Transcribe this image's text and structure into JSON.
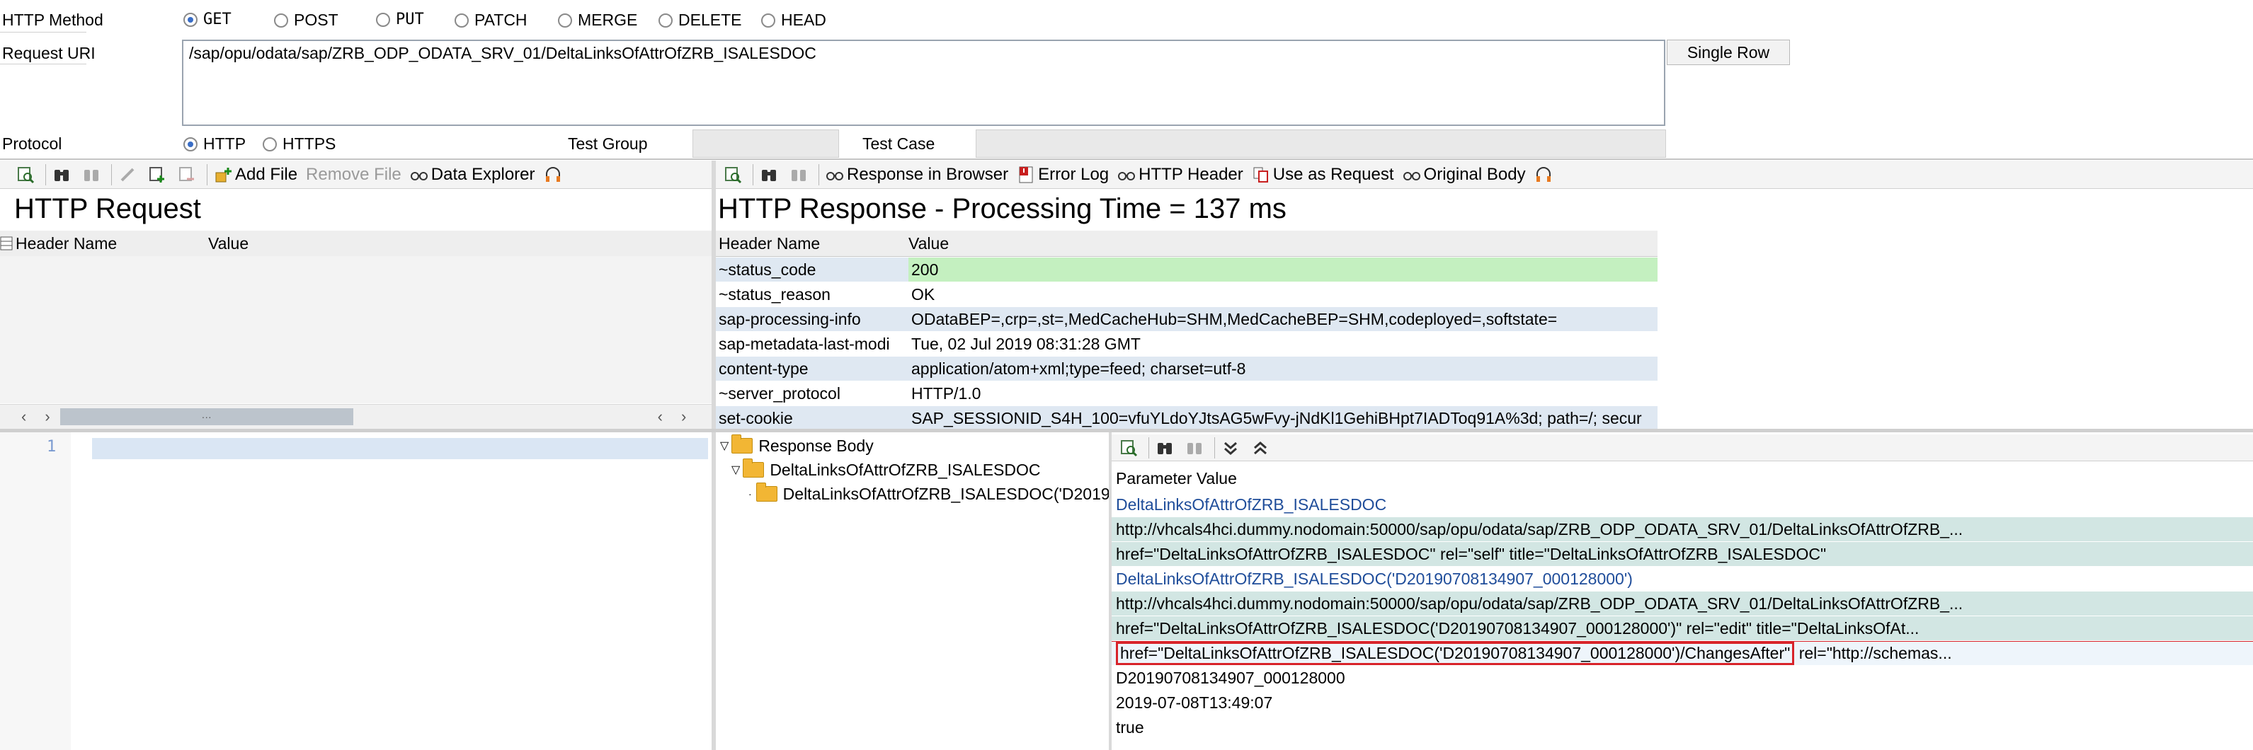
{
  "request": {
    "method_label": "HTTP Method",
    "methods": [
      "GET",
      "POST",
      "PUT",
      "PATCH",
      "MERGE",
      "DELETE",
      "HEAD"
    ],
    "selected_method": "GET",
    "uri_label": "Request URI",
    "uri_value": "/sap/opu/odata/sap/ZRB_ODP_ODATA_SRV_01/DeltaLinksOfAttrOfZRB_ISALESDOC",
    "single_row_label": "Single Row",
    "protocol_label": "Protocol",
    "protocols": [
      "HTTP",
      "HTTPS"
    ],
    "selected_protocol": "HTTP",
    "test_group_label": "Test Group",
    "test_group_value": "",
    "test_case_label": "Test Case",
    "test_case_value": ""
  },
  "left_toolbar": {
    "add_file": "Add File",
    "remove_file": "Remove File",
    "data_explorer": "Data Explorer"
  },
  "http_request": {
    "title": "HTTP Request",
    "col_header_name": "Header Name",
    "col_value": "Value",
    "scroll_left": "‹",
    "scroll_right": "›",
    "scroll_thumb": "···"
  },
  "right_toolbar": {
    "response_in_browser": "Response in Browser",
    "error_log": "Error Log",
    "http_header": "HTTP Header",
    "use_as_request": "Use as Request",
    "original_body": "Original Body"
  },
  "http_response": {
    "title": "HTTP Response - Processing Time = 137  ms",
    "col_header_name": "Header Name",
    "col_value": "Value",
    "rows": [
      {
        "name": "~status_code",
        "value": "200"
      },
      {
        "name": "~status_reason",
        "value": "OK"
      },
      {
        "name": "sap-processing-info",
        "value": "ODataBEP=,crp=,st=,MedCacheHub=SHM,MedCacheBEP=SHM,codeployed=,softstate="
      },
      {
        "name": "sap-metadata-last-modi",
        "value": "Tue, 02 Jul 2019 08:31:28 GMT"
      },
      {
        "name": "content-type",
        "value": "application/atom+xml;type=feed; charset=utf-8"
      },
      {
        "name": "~server_protocol",
        "value": "HTTP/1.0"
      },
      {
        "name": "set-cookie",
        "value": "SAP_SESSIONID_S4H_100=vfuYLdoYJtsAG5wFvy-jNdKl1GehiBHpt7IADToq91A%3d; path=/; secur"
      }
    ]
  },
  "editor": {
    "line_number": "1"
  },
  "tree": {
    "root": "Response Body",
    "child": "DeltaLinksOfAttrOfZRB_ISALESDOC",
    "grandchild": "DeltaLinksOfAttrOfZRB_ISALESDOC('D2019"
  },
  "param_panel": {
    "header": "Parameter Value",
    "rows": [
      {
        "text": "DeltaLinksOfAttrOfZRB_ISALESDOC",
        "style": "link"
      },
      {
        "text": "http://vhcals4hci.dummy.nodomain:50000/sap/opu/odata/sap/ZRB_ODP_ODATA_SRV_01/DeltaLinksOfAttrOfZRB_...",
        "style": "teal"
      },
      {
        "text": "href=\"DeltaLinksOfAttrOfZRB_ISALESDOC\" rel=\"self\" title=\"DeltaLinksOfAttrOfZRB_ISALESDOC\"",
        "style": "teal"
      },
      {
        "text": "DeltaLinksOfAttrOfZRB_ISALESDOC('D20190708134907_000128000')",
        "style": "link"
      },
      {
        "text": "http://vhcals4hci.dummy.nodomain:50000/sap/opu/odata/sap/ZRB_ODP_ODATA_SRV_01/DeltaLinksOfAttrOfZRB_...",
        "style": "teal"
      },
      {
        "text": "href=\"DeltaLinksOfAttrOfZRB_ISALESDOC('D20190708134907_000128000')\" rel=\"edit\" title=\"DeltaLinksOfAt...",
        "style": "teal"
      },
      {
        "text_highlight": "href=\"DeltaLinksOfAttrOfZRB_ISALESDOC('D20190708134907_000128000')/ChangesAfter\"",
        "text_rest": " rel=\"http://schemas...",
        "style": "selected"
      },
      {
        "text": "D20190708134907_000128000",
        "style": "plain"
      },
      {
        "text": "2019-07-08T13:49:07",
        "style": "plain"
      },
      {
        "text": "true",
        "style": "plain"
      }
    ]
  },
  "colors": {
    "accent_blue": "#3a6ec6",
    "status_green": "#c4f0c0",
    "row_blue": "#dfe8f2",
    "row_teal": "#d2e6e3",
    "highlight_red": "#d8232a"
  }
}
